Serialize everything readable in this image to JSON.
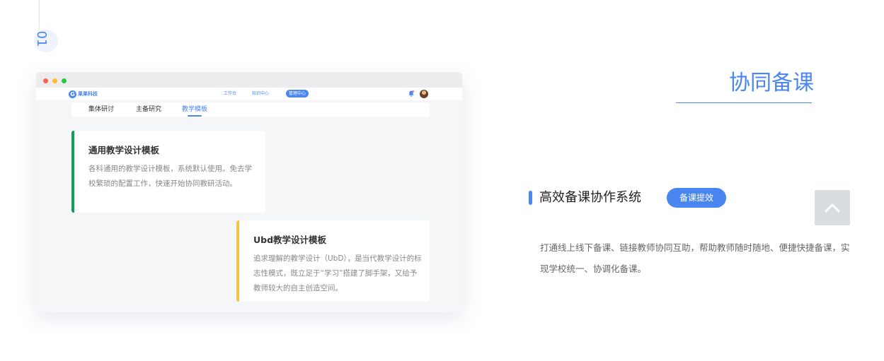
{
  "step": {
    "number": "01"
  },
  "window": {
    "app": {
      "logo_letter": "G",
      "logo_text": "果果科技"
    },
    "nav": [
      {
        "label": "工作台",
        "active": false
      },
      {
        "label": "知识中心",
        "active": false
      },
      {
        "label": "管理中心",
        "active": true
      }
    ],
    "subtabs": [
      {
        "label": "集体研讨",
        "active": false
      },
      {
        "label": "主备研究",
        "active": false
      },
      {
        "label": "教学模板",
        "active": true
      }
    ],
    "cards": [
      {
        "title": "通用教学设计模板",
        "description": "各科通用的教学设计模板，系统默认使用。免去学校繁琐的配置工作，快速开始协同教研活动。",
        "accent": "#0f9d58"
      },
      {
        "title": "Ubd教学设计模板",
        "description": "追求理解的教学设计（UbD），是当代教学设计的标志性模式，既立足于“学习”搭建了脚手架，又给予教师较大的自主创造空间。",
        "accent": "#f6c445"
      }
    ]
  },
  "feature": {
    "title": "协同备课",
    "subheading": "高效备课协作系统",
    "badge": "备课提效",
    "description": "打通线上线下备课、链接教师协同互助，帮助教师随时随地、便捷快捷备课，实现学校统一、协调化备课。"
  },
  "colors": {
    "accent": "#4a86f0",
    "green": "#0f9d58",
    "yellow": "#f6c445"
  },
  "icons": {
    "back_to_top": "chevron-up-icon",
    "notification": "bell-icon"
  }
}
